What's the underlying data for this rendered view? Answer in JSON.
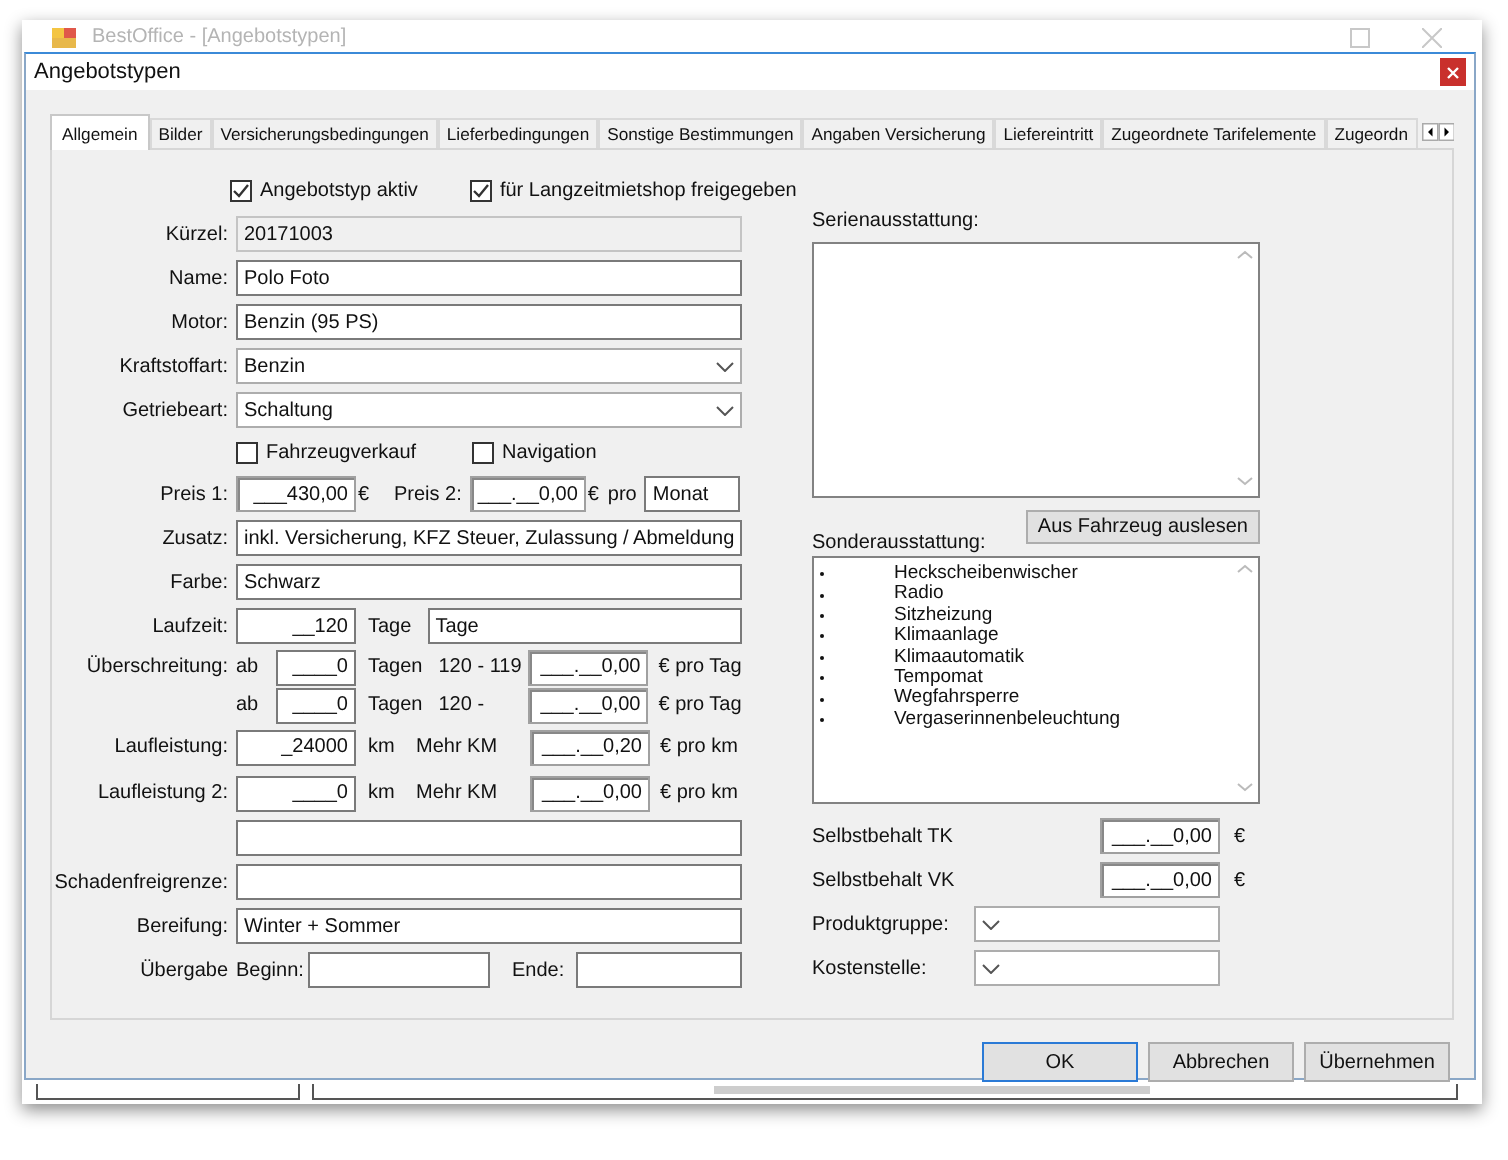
{
  "background_window": {
    "title": "BestOffice - [Angebotstypen]"
  },
  "dialog": {
    "title": "Angebotstypen"
  },
  "tabs": [
    {
      "label": "Allgemein",
      "selected": true
    },
    {
      "label": "Bilder",
      "selected": false
    },
    {
      "label": "Versicherungsbedingungen",
      "selected": false
    },
    {
      "label": "Lieferbedingungen",
      "selected": false
    },
    {
      "label": "Sonstige Bestimmungen",
      "selected": false
    },
    {
      "label": "Angaben Versicherung",
      "selected": false
    },
    {
      "label": "Liefereintritt",
      "selected": false
    },
    {
      "label": "Zugeordnete Tarifelemente",
      "selected": false
    },
    {
      "label": "Zugeordn",
      "selected": false
    }
  ],
  "top_checkboxes": [
    {
      "label": "Angebotstyp aktiv",
      "checked": true
    },
    {
      "label": "für Langzeitmietshop freigegeben",
      "checked": true
    }
  ],
  "rows": [
    {
      "kind": "text",
      "label": "Kürzel:",
      "value": "20171003",
      "disabled": true
    },
    {
      "kind": "text",
      "label": "Name:",
      "value": "Polo Foto",
      "disabled": false
    },
    {
      "kind": "text",
      "label": "Motor:",
      "value": "Benzin (95 PS)",
      "disabled": false
    },
    {
      "kind": "select",
      "label": "Kraftstoffart:",
      "value": "Benzin"
    },
    {
      "kind": "select",
      "label": "Getriebeart:",
      "value": "Schaltung"
    },
    {
      "kind": "checks",
      "items": [
        {
          "label": "Fahrzeugverkauf",
          "checked": false
        },
        {
          "label": "Navigation",
          "checked": false
        }
      ]
    },
    {
      "kind": "prices",
      "label": "Preis 1:",
      "value": "___430,00",
      "unit": "€",
      "label2": "Preis 2:",
      "value2": "___.__0,00",
      "unit2": "€",
      "per": "pro",
      "period": "Monat"
    },
    {
      "kind": "text",
      "label": "Zusatz:",
      "value": "inkl. Versicherung, KFZ Steuer, Zulassung / Abmeldung",
      "disabled": false
    },
    {
      "kind": "text",
      "label": "Farbe:",
      "value": "Schwarz",
      "disabled": false
    },
    {
      "kind": "duration",
      "label": "Laufzeit:",
      "value": "__120",
      "unit": "Tage",
      "extra": "Tage"
    },
    {
      "kind": "overage",
      "label": "Überschreitung:",
      "ab": "ab",
      "value": "____0",
      "unit": "Tagen",
      "range": "120 - 119",
      "price": "___.__0,00",
      "price_unit": "€ pro Tag"
    },
    {
      "kind": "overage",
      "ab": "ab",
      "value": "____0",
      "unit": "Tagen",
      "range": "120 -",
      "price": "___.__0,00",
      "price_unit": "€ pro Tag"
    },
    {
      "kind": "mileage",
      "label": "Laufleistung:",
      "value": "_24000",
      "unit": "km",
      "extra_label": "Mehr KM",
      "price": "___.__0,20",
      "price_unit": "€ pro km"
    },
    {
      "kind": "mileage",
      "label": "Laufleistung 2:",
      "value": "____0",
      "unit": "km",
      "extra_label": "Mehr KM",
      "price": "___.__0,00",
      "price_unit": "€ pro km"
    },
    {
      "kind": "text",
      "disabled": false
    },
    {
      "kind": "text",
      "label": "Schadenfreigrenze:",
      "disabled": false
    },
    {
      "kind": "text",
      "label": "Bereifung:",
      "value": "Winter + Sommer",
      "disabled": false
    },
    {
      "kind": "range",
      "label": "Übergabe",
      "from_label": "Beginn:",
      "to_label": "Ende:"
    }
  ],
  "serienausstattung": {
    "label": "Serienausstattung:"
  },
  "sonderausstattung": {
    "label": "Sonderausstattung:",
    "button": "Aus Fahrzeug auslesen",
    "items": [
      "Heckscheibenwischer",
      "Radio",
      "Sitzheizung",
      "Klimaanlage",
      "Klimaautomatik",
      "Tempomat",
      "Wegfahrsperre",
      "Vergaserinnenbeleuchtung"
    ]
  },
  "amounts": [
    {
      "label": "Selbstbehalt TK",
      "value": "___.__0,00",
      "unit": "€"
    },
    {
      "label": "Selbstbehalt VK",
      "value": "___.__0,00",
      "unit": "€"
    }
  ],
  "selects": [
    {
      "label": "Produktgruppe:"
    },
    {
      "label": "Kostenstelle:"
    }
  ],
  "buttons": [
    {
      "label": "OK",
      "default": true
    },
    {
      "label": "Abbrechen",
      "default": false
    },
    {
      "label": "Übernehmen",
      "default": false
    }
  ]
}
